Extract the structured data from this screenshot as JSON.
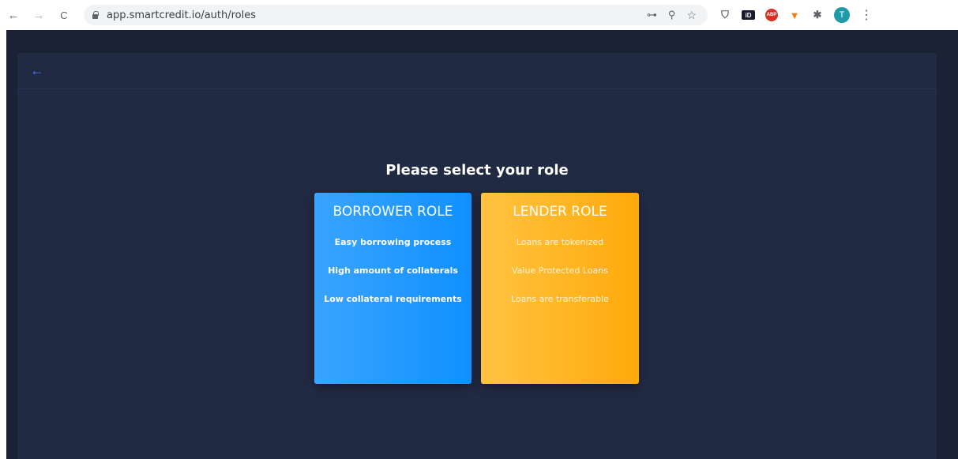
{
  "browser": {
    "url": "app.smartcredit.io/auth/roles",
    "back_glyph": "←",
    "forward_glyph": "→",
    "reload_glyph": "C",
    "key_glyph": "⊶",
    "zoom_glyph": "⚲",
    "star_glyph": "☆",
    "extensions": {
      "shield_glyph": "⛉",
      "id_label": "iD",
      "abp_label": "ABP",
      "fox_glyph": "▼",
      "puzzle_glyph": "✱"
    },
    "profile_initial": "T",
    "menu_glyph": "⋮"
  },
  "app": {
    "back_glyph": "←",
    "title": "Please select your role",
    "roles": [
      {
        "name": "BORROWER ROLE",
        "features": [
          "Easy borrowing process",
          "High amount of collaterals",
          "Low collateral requirements"
        ],
        "color": "#1a96ff"
      },
      {
        "name": "LENDER ROLE",
        "features": [
          "Loans are tokenized",
          "Value Protected Loans",
          "Loans are transferable"
        ],
        "color": "#ffb21a"
      }
    ]
  },
  "colors": {
    "background": "#1c2236",
    "panel": "#212a43",
    "accent": "#3f7bff"
  }
}
